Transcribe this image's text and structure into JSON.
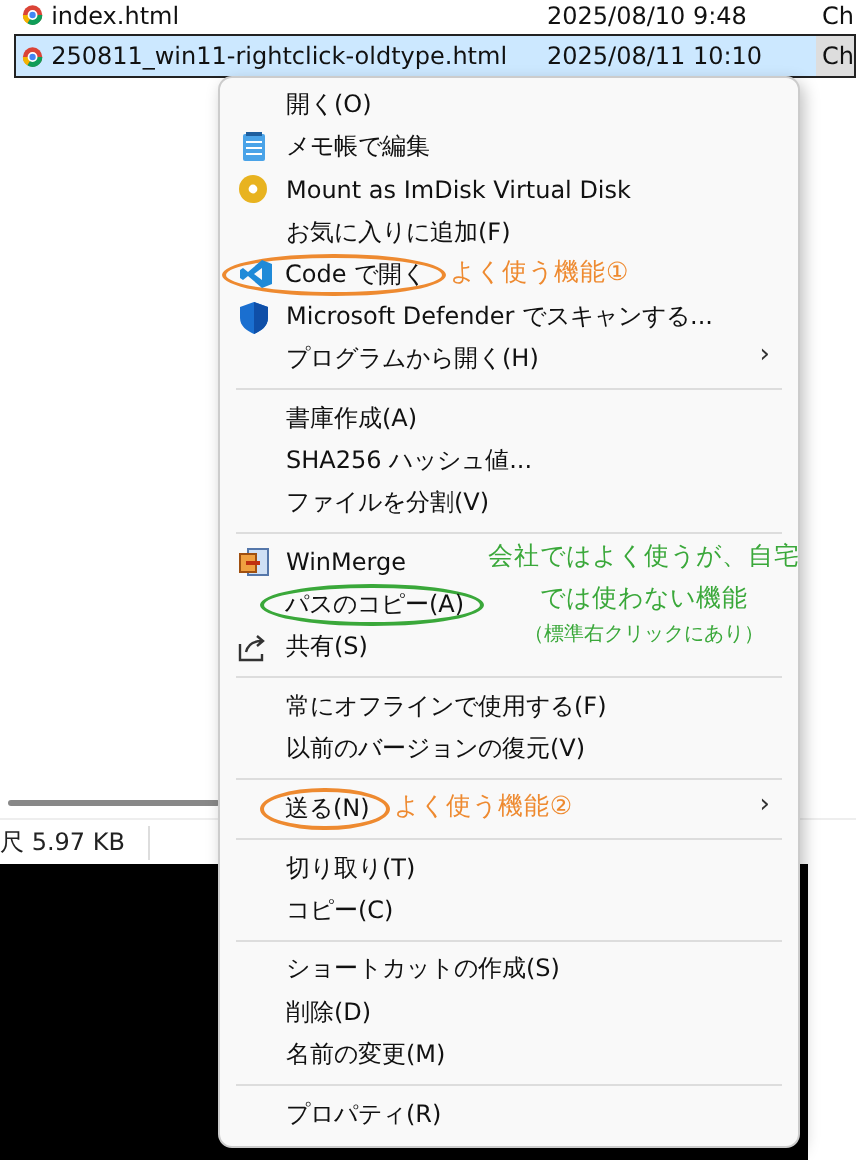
{
  "files": [
    {
      "name": "index.html",
      "date": "2025/08/10 9:48",
      "type": "Ch",
      "selected": false
    },
    {
      "name": "250811_win11-rightclick-oldtype.html",
      "date": "2025/08/11 10:10",
      "type": "Ch",
      "selected": true
    }
  ],
  "status_bar": {
    "size": "尺 5.97 KB"
  },
  "menu": [
    {
      "kind": "item",
      "label": "開く(O)"
    },
    {
      "kind": "item",
      "label": "メモ帳で編集"
    },
    {
      "kind": "item",
      "label": "Mount as ImDisk Virtual Disk"
    },
    {
      "kind": "item",
      "label": "お気に入りに追加(F)"
    },
    {
      "kind": "item",
      "label": "Code で開く",
      "note": {
        "color": "#ee8a30",
        "lines": [
          "よく使う機能①"
        ]
      }
    },
    {
      "kind": "item",
      "label": "Microsoft Defender でスキャンする..."
    },
    {
      "kind": "item",
      "label": "プログラムから開く(H)",
      "arrow": "›"
    },
    {
      "kind": "separator"
    },
    {
      "kind": "item",
      "label": "書庫作成(A)"
    },
    {
      "kind": "item",
      "label": "SHA256 ハッシュ値..."
    },
    {
      "kind": "item",
      "label": "ファイルを分割(V)"
    },
    {
      "kind": "separator"
    },
    {
      "kind": "item",
      "label": "WinMerge"
    },
    {
      "kind": "item",
      "label": "パスのコピー(A)",
      "note": {
        "color": "#3aa83a",
        "lines": [
          "会社ではよく使うが、自宅",
          "では使わない機能",
          "（標準右クリックにあり）"
        ]
      }
    },
    {
      "kind": "item",
      "label": "共有(S)"
    },
    {
      "kind": "separator"
    },
    {
      "kind": "item",
      "label": "常にオフラインで使用する(F)"
    },
    {
      "kind": "item",
      "label": "以前のバージョンの復元(V)"
    },
    {
      "kind": "separator"
    },
    {
      "kind": "item",
      "label": "送る(N)",
      "arrow": "›",
      "note": {
        "color": "#ee8a30",
        "lines": [
          "よく使う機能②"
        ]
      }
    },
    {
      "kind": "separator"
    },
    {
      "kind": "item",
      "label": "切り取り(T)"
    },
    {
      "kind": "item",
      "label": "コピー(C)"
    },
    {
      "kind": "separator"
    },
    {
      "kind": "item",
      "label": "ショートカットの作成(S)"
    },
    {
      "kind": "item",
      "label": "削除(D)"
    },
    {
      "kind": "item",
      "label": "名前の変更(M)"
    },
    {
      "kind": "separator"
    },
    {
      "kind": "item",
      "label": "プロパティ(R)"
    }
  ]
}
